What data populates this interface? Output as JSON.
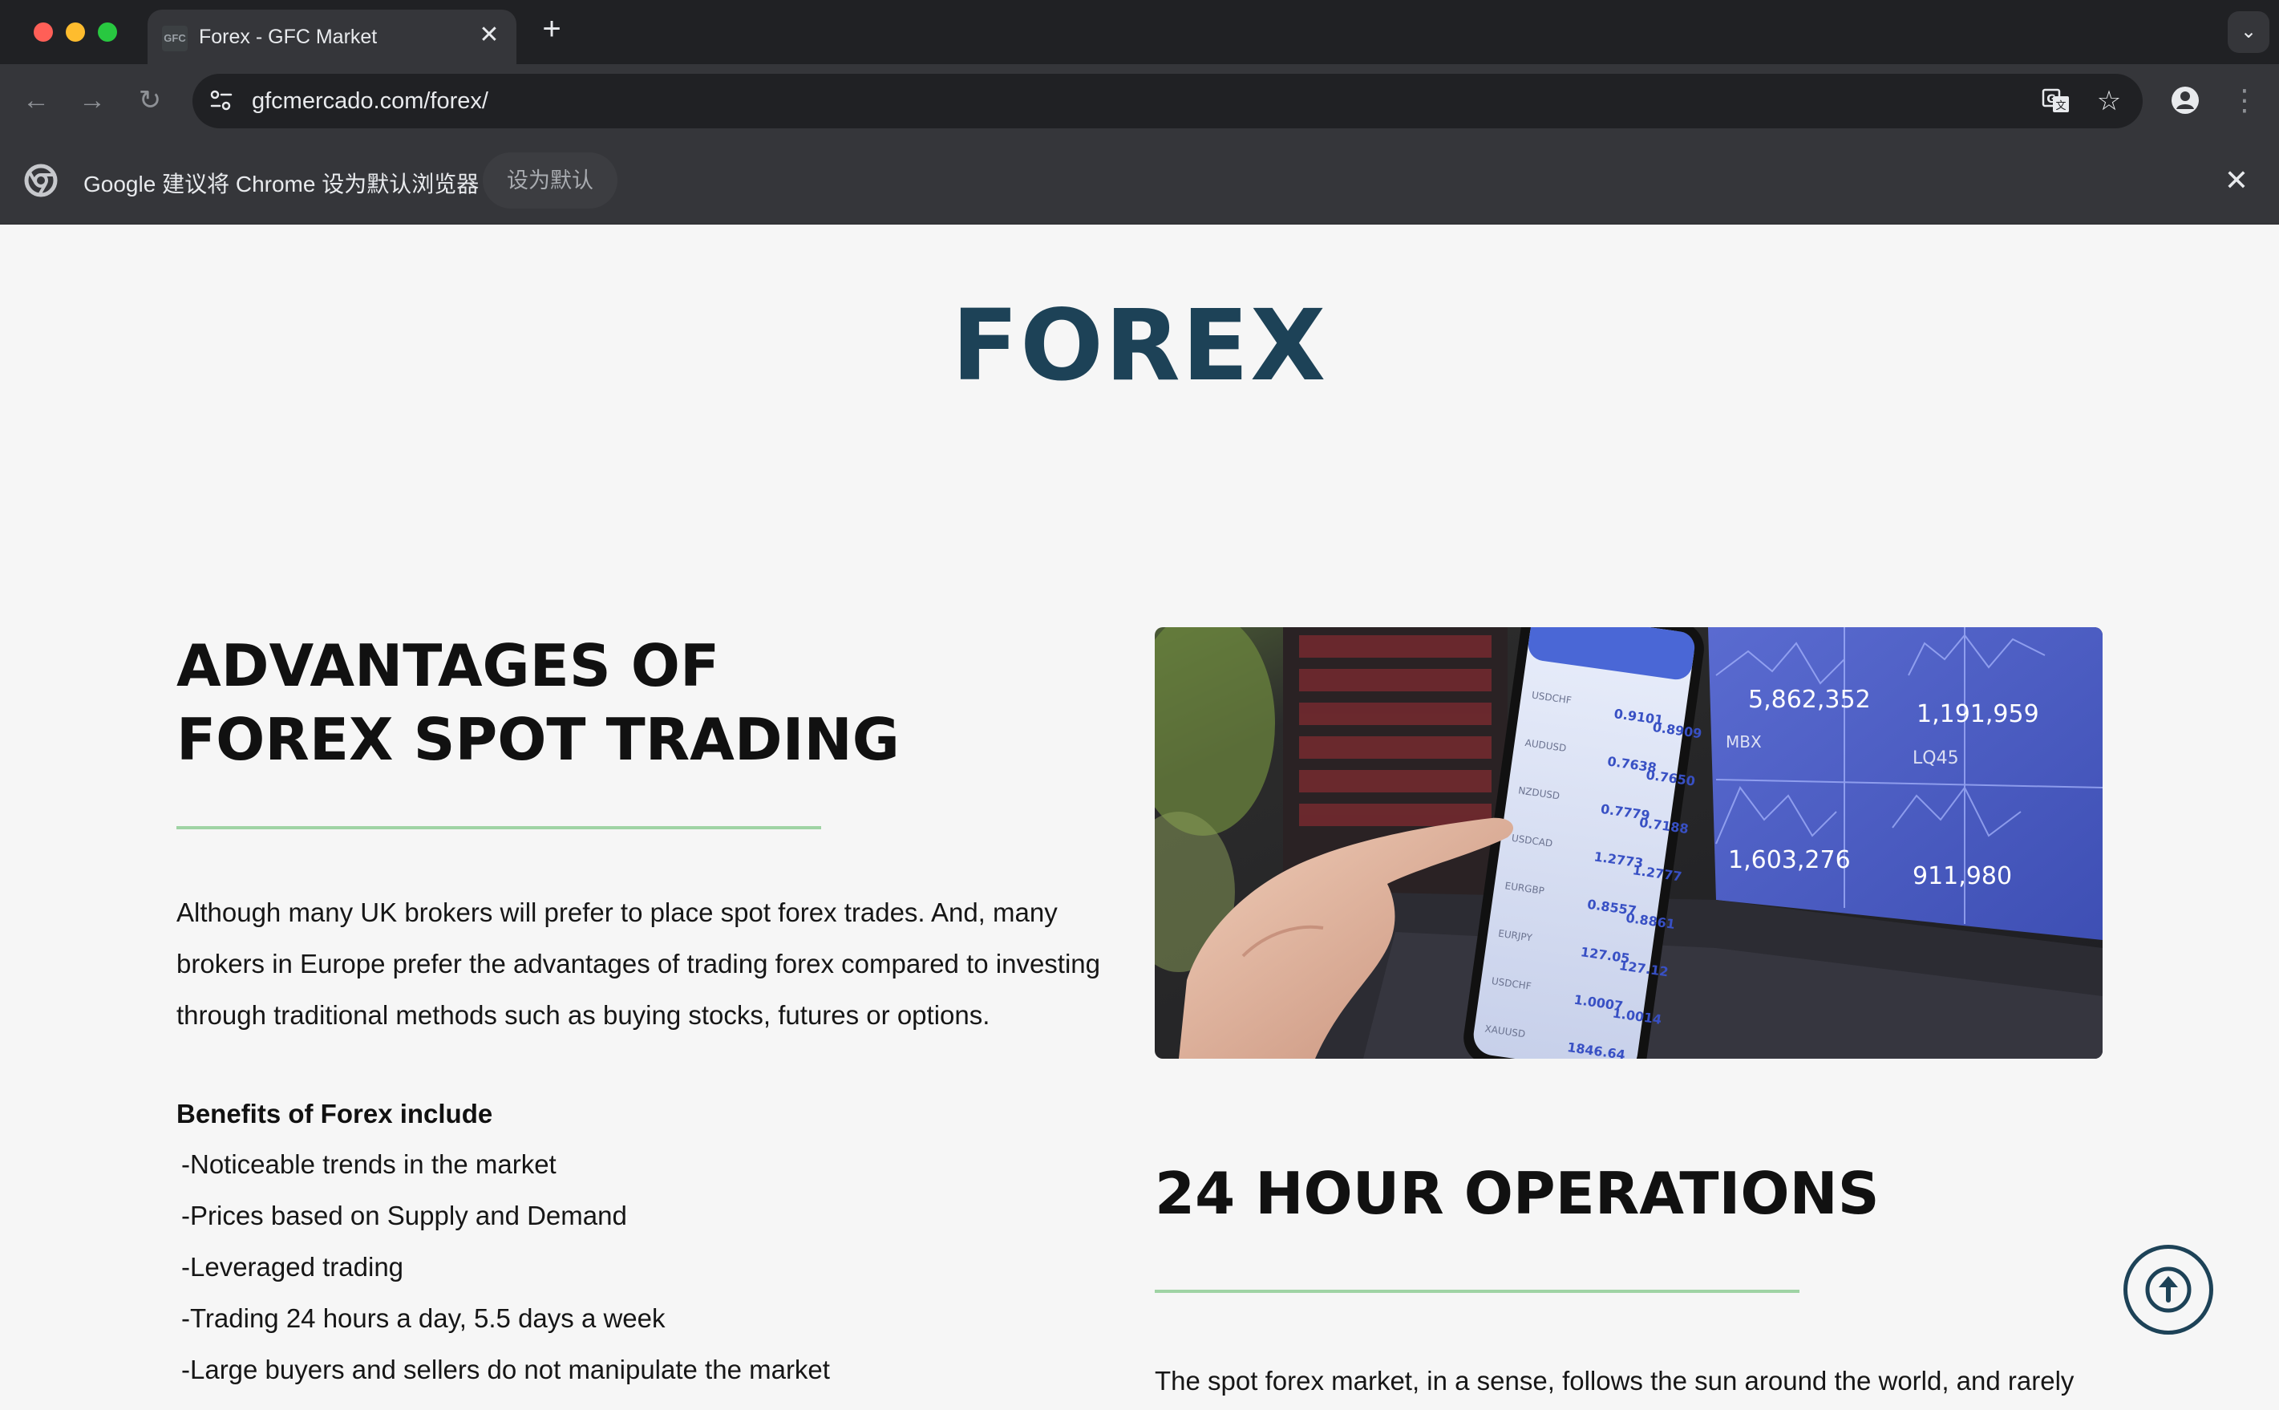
{
  "browser": {
    "tab": {
      "favicon_text": "GFC",
      "title": "Forex - GFC Market",
      "close_glyph": "✕"
    },
    "new_tab_glyph": "+",
    "tab_dropdown_glyph": "⌄",
    "nav": {
      "back_glyph": "←",
      "forward_glyph": "→",
      "reload_glyph": "↻"
    },
    "address_bar": {
      "url": "gfcmercado.com/forex/"
    },
    "bookmark_glyph": "☆",
    "menu_glyph": "⋮",
    "infobar": {
      "message": "Google 建议将 Chrome 设为默认浏览器",
      "button_label": "设为默认",
      "close_glyph": "✕"
    }
  },
  "page": {
    "title": "FOREX",
    "advantages": {
      "heading_line1": "ADVANTAGES OF",
      "heading_line2": "FOREX SPOT TRADING",
      "paragraph": "Although many UK brokers will prefer to place spot forex trades. And, many brokers in Europe prefer the advantages of trading forex compared to investing through traditional methods such as buying stocks, futures or options.",
      "benefits_title": "Benefits of Forex include",
      "benefits": [
        "-Noticeable trends in the market",
        "-Prices based on Supply and Demand",
        "-Leveraged trading",
        "-Trading 24 hours a day, 5.5 days a week",
        "-Large buyers and sellers do not manipulate the market"
      ]
    },
    "operations": {
      "heading": "24 HOUR OPERATIONS",
      "paragraph": "The spot forex market, in a sense, follows the sun around the world, and rarely"
    },
    "image": {
      "prices": {
        "p1": "5,862,352",
        "p2": "1,191,959",
        "p3": "1,603,276",
        "p4": "911,980",
        "t1": "MBX",
        "t2": "LQ45"
      }
    }
  },
  "colors": {
    "title_color": "#1d4257",
    "divider_color": "#9fd3a4",
    "chrome_dark": "#202124",
    "chrome_toolbar": "#35363a"
  },
  "icons": {
    "scroll_top": "arrow-up-circle-icon",
    "site_info": "tune-icon",
    "translate": "translate-icon",
    "profile": "person-icon"
  }
}
